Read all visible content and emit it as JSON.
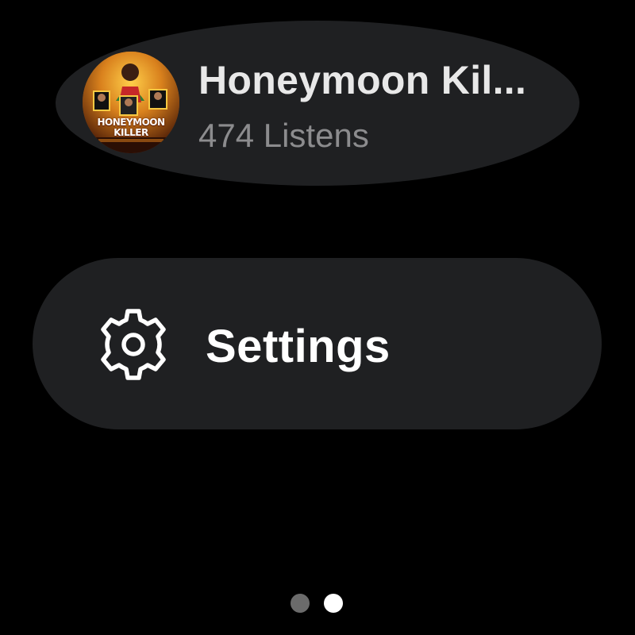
{
  "episode_chip": {
    "title": "Honeymoon Kil...",
    "subtitle": "474 Listens",
    "thumbnail": {
      "text_line_1": "HONEYMOON",
      "text_line_2": "KILLER"
    }
  },
  "settings_chip": {
    "label": "Settings",
    "icon": "gear-icon"
  },
  "page_indicator": {
    "total": 2,
    "active_index": 1
  },
  "colors": {
    "background": "#000000",
    "chip": "#1f2022",
    "title_text": "#e8e8e8",
    "subtitle_text": "#8c8c8e",
    "label_text": "#ffffff",
    "dot_inactive": "#6b6b6b",
    "dot_active": "#ffffff"
  }
}
